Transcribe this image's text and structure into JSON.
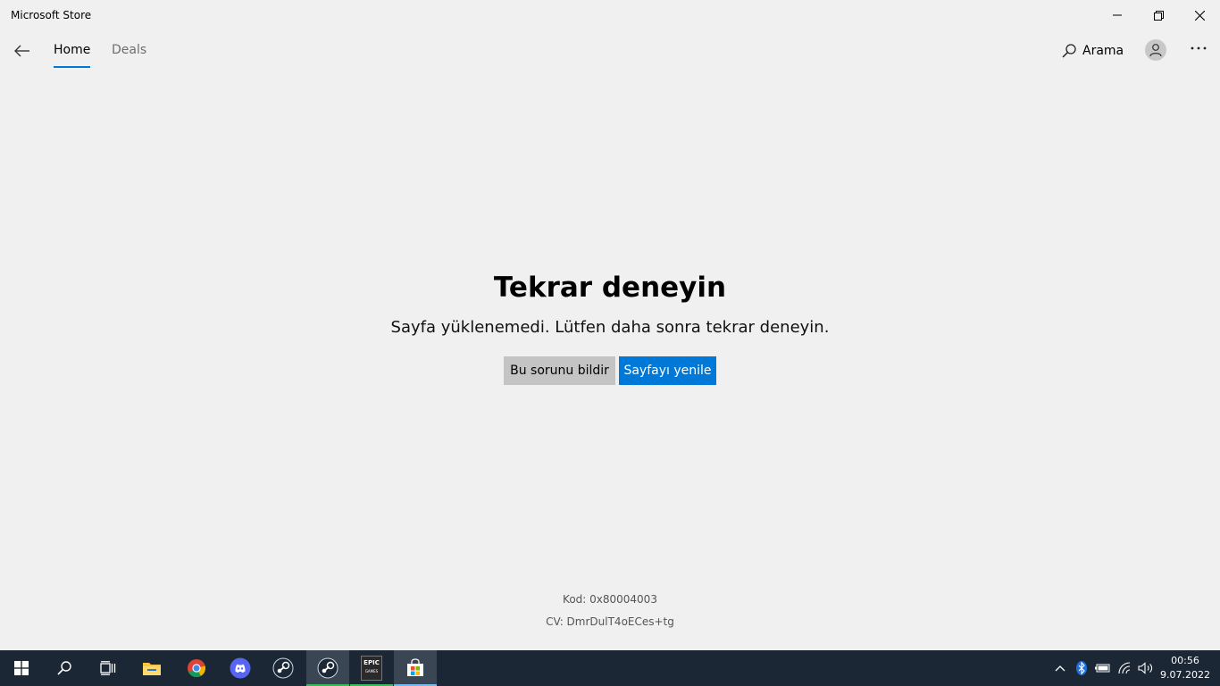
{
  "window": {
    "title": "Microsoft Store"
  },
  "nav": {
    "tabs": [
      {
        "label": "Home",
        "active": true
      },
      {
        "label": "Deals",
        "active": false
      }
    ],
    "search_label": "Arama"
  },
  "error": {
    "title": "Tekrar deneyin",
    "message": "Sayfa yüklenemedi. Lütfen daha sonra tekrar deneyin.",
    "report_button": "Bu sorunu bildir",
    "refresh_button": "Sayfayı yenile",
    "code": "Kod: 0x80004003",
    "cv": "CV: DmrDulT4oECes+tg"
  },
  "taskbar": {
    "apps": [
      "windows-start-icon",
      "search-icon",
      "task-view-icon",
      "file-explorer-icon",
      "chrome-icon",
      "discord-icon",
      "steam-icon",
      "steam-icon",
      "epic-games-icon",
      "microsoft-store-icon"
    ],
    "epic_label": "EPIC",
    "epic_sub": "GAMES",
    "time": "00:56",
    "date": "9.07.2022"
  },
  "colors": {
    "accent": "#0078d7",
    "taskbar": "#1b2735",
    "background": "#f0f0f0"
  }
}
